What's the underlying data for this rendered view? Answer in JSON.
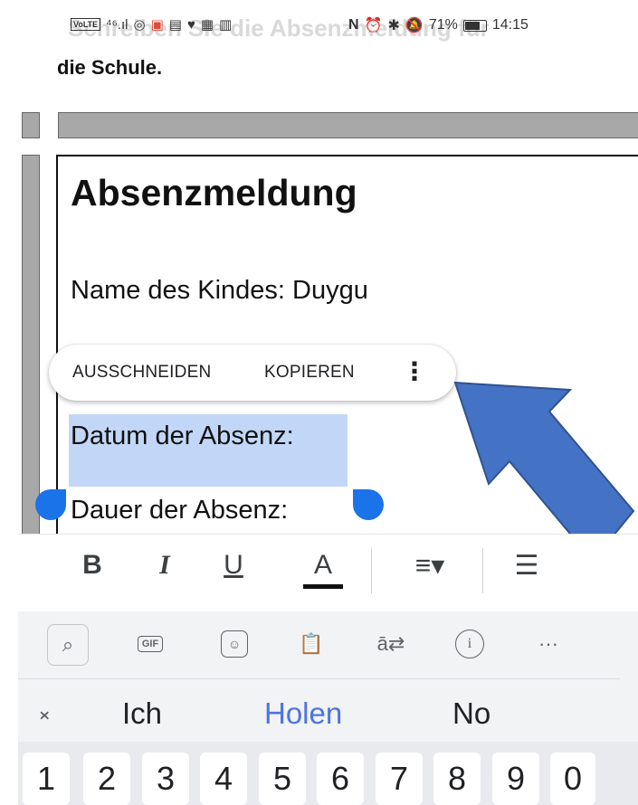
{
  "status_bar": {
    "volte": "VoLTE",
    "signal": "⁴⁶.ıl",
    "time": "14:15",
    "battery_percent": "71%",
    "nfc_label": "N"
  },
  "ghost_heading": "Schreiben Sie die Absenzmeldung für",
  "subtitle": "die Schule.",
  "document": {
    "title": "Absenzmeldung",
    "lines": [
      "Name des Kindes: Duygu",
      "Datum der Absenz:",
      "Dauer der Absenz:"
    ],
    "selected_text": "Datum der Absenz"
  },
  "context_menu": {
    "cut": "AUSSCHNEIDEN",
    "copy": "KOPIEREN",
    "more": "⋮"
  },
  "toolbar": {
    "bold": "B",
    "italic": "I",
    "underline": "U",
    "text_color": "A",
    "align": "≡▾",
    "list": "☰"
  },
  "keyboard": {
    "gif": "GIF",
    "more": "···",
    "collapse": "⌄⌃",
    "suggestions": [
      "Ich",
      "Holen",
      "No"
    ],
    "highlighted_suggestion": "Holen",
    "number_keys": [
      "1",
      "2",
      "3",
      "4",
      "5",
      "6",
      "7",
      "8",
      "9",
      "0"
    ]
  },
  "colors": {
    "selection": "#c2d7f7",
    "handle": "#1a73e8",
    "arrow": "#4472c4",
    "suggestion_accent": "#4e74e0"
  }
}
